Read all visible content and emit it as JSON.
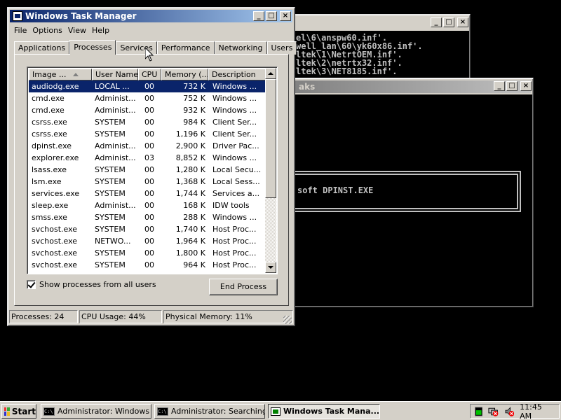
{
  "console_back": {
    "lines": [
      "el\\6\\anspw60.inf'.",
      "well_lan\\60\\yk60x86.inf'.",
      "ltek\\1\\NetrtOEM.inf'.",
      "ltek\\2\\netrtx32.inf'.",
      "ltek\\3\\NET8185.inf'."
    ]
  },
  "console_front": {
    "title": "aks",
    "box_text": "soft DPINST.EXE"
  },
  "taskmgr": {
    "title": "Windows Task Manager",
    "menu": [
      "File",
      "Options",
      "View",
      "Help"
    ],
    "tabs": [
      "Applications",
      "Processes",
      "Services",
      "Performance",
      "Networking",
      "Users"
    ],
    "active_tab": "Processes",
    "columns": {
      "name": "Image ...",
      "user": "User Name",
      "cpu": "CPU",
      "mem": "Memory (...",
      "desc": "Description"
    },
    "rows": [
      {
        "name": "audiodg.exe",
        "user": "LOCAL ...",
        "cpu": "00",
        "mem": "732 K",
        "desc": "Windows ..."
      },
      {
        "name": "cmd.exe",
        "user": "Administ...",
        "cpu": "00",
        "mem": "752 K",
        "desc": "Windows ..."
      },
      {
        "name": "cmd.exe",
        "user": "Administ...",
        "cpu": "00",
        "mem": "932 K",
        "desc": "Windows ..."
      },
      {
        "name": "csrss.exe",
        "user": "SYSTEM",
        "cpu": "00",
        "mem": "984 K",
        "desc": "Client Ser..."
      },
      {
        "name": "csrss.exe",
        "user": "SYSTEM",
        "cpu": "00",
        "mem": "1,196 K",
        "desc": "Client Ser..."
      },
      {
        "name": "dpinst.exe",
        "user": "Administ...",
        "cpu": "00",
        "mem": "2,900 K",
        "desc": "Driver Pac..."
      },
      {
        "name": "explorer.exe",
        "user": "Administ...",
        "cpu": "03",
        "mem": "8,852 K",
        "desc": "Windows ..."
      },
      {
        "name": "lsass.exe",
        "user": "SYSTEM",
        "cpu": "00",
        "mem": "1,280 K",
        "desc": "Local Secu..."
      },
      {
        "name": "lsm.exe",
        "user": "SYSTEM",
        "cpu": "00",
        "mem": "1,368 K",
        "desc": "Local Sess..."
      },
      {
        "name": "services.exe",
        "user": "SYSTEM",
        "cpu": "00",
        "mem": "1,744 K",
        "desc": "Services a..."
      },
      {
        "name": "sleep.exe",
        "user": "Administ...",
        "cpu": "00",
        "mem": "168 K",
        "desc": "IDW tools"
      },
      {
        "name": "smss.exe",
        "user": "SYSTEM",
        "cpu": "00",
        "mem": "288 K",
        "desc": "Windows ..."
      },
      {
        "name": "svchost.exe",
        "user": "SYSTEM",
        "cpu": "00",
        "mem": "1,740 K",
        "desc": "Host Proc..."
      },
      {
        "name": "svchost.exe",
        "user": "NETWO...",
        "cpu": "00",
        "mem": "1,964 K",
        "desc": "Host Proc..."
      },
      {
        "name": "svchost.exe",
        "user": "SYSTEM",
        "cpu": "00",
        "mem": "1,800 K",
        "desc": "Host Proc..."
      },
      {
        "name": "svchost.exe",
        "user": "SYSTEM",
        "cpu": "00",
        "mem": "964 K",
        "desc": "Host Proc..."
      }
    ],
    "show_all_label": "Show processes from all users",
    "show_all_checked": true,
    "end_process_label": "End Process",
    "status": {
      "processes": "Processes: 24",
      "cpu": "CPU Usage: 44%",
      "memory": "Physical Memory: 11%"
    }
  },
  "taskbar": {
    "start_label": "Start",
    "buttons": [
      {
        "label": "Administrator:  Windows ..."
      },
      {
        "label": "Administrator:  Searching ..."
      },
      {
        "label": "Windows Task Mana..."
      }
    ],
    "clock": "11:45 AM"
  },
  "colors": {
    "selection": "#0a246a",
    "active_title_start": "#0a246a",
    "active_title_end": "#a6caf0",
    "face": "#d4d0c8",
    "desktop": "#000000"
  }
}
